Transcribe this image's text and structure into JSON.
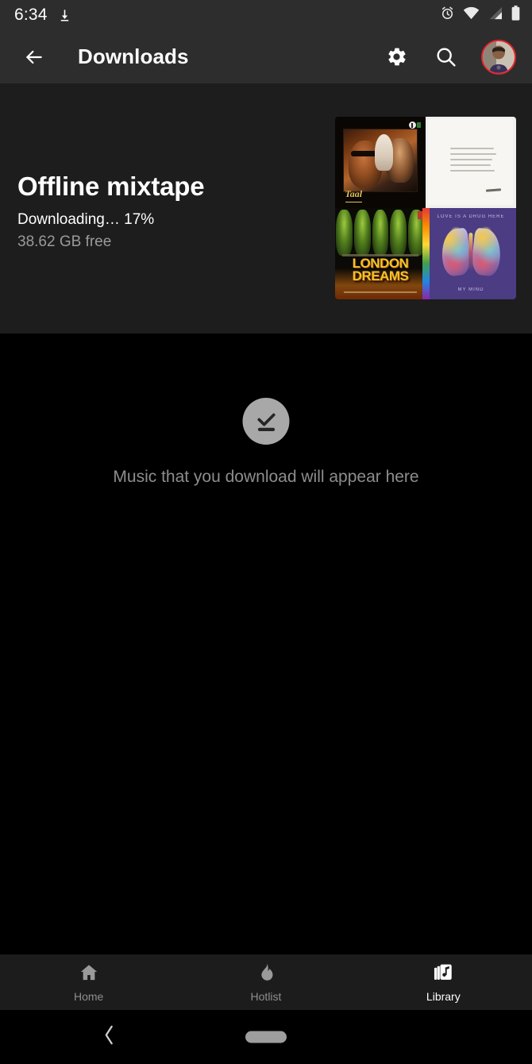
{
  "status_bar": {
    "time": "6:34",
    "download_icon": "download-icon",
    "alarm_icon": "alarm-clock-icon",
    "wifi_icon": "wifi-icon",
    "signal_icon": "cell-signal-icon",
    "battery_icon": "battery-icon"
  },
  "app_bar": {
    "back_icon": "back-arrow-icon",
    "title": "Downloads",
    "settings_icon": "gear-icon",
    "search_icon": "search-icon",
    "avatar": "account-avatar"
  },
  "hero": {
    "title": "Offline mixtape",
    "status": "Downloading… 17%",
    "storage": "38.62 GB free",
    "progress_percent": 17,
    "album_art": [
      {
        "name": "taal-album-art",
        "title": "Taal"
      },
      {
        "name": "handwritten-note-album-art",
        "title": ""
      },
      {
        "name": "london-dreams-album-art",
        "title": "LONDON DREAMS"
      },
      {
        "name": "purple-butterfly-album-art",
        "top_text": "LOVE IS A DRUG HERE",
        "bottom_text": "MY MIND"
      }
    ]
  },
  "empty_state": {
    "icon": "download-done-icon",
    "message": "Music that you download will appear here"
  },
  "bottom_nav": {
    "items": [
      {
        "label": "Home",
        "icon": "home-icon",
        "active": false
      },
      {
        "label": "Hotlist",
        "icon": "flame-icon",
        "active": false
      },
      {
        "label": "Library",
        "icon": "library-music-icon",
        "active": true
      }
    ]
  },
  "system_nav": {
    "back_icon": "system-back-chevron",
    "home_indicator": "home-pill"
  },
  "colors": {
    "accent_red": "#e8242a",
    "app_bar_bg": "#2d2d2d",
    "hero_bg": "#1d1d1d",
    "body_bg": "#000000",
    "nav_bg": "#1c1c1c",
    "muted_text": "#8d8d8d"
  }
}
